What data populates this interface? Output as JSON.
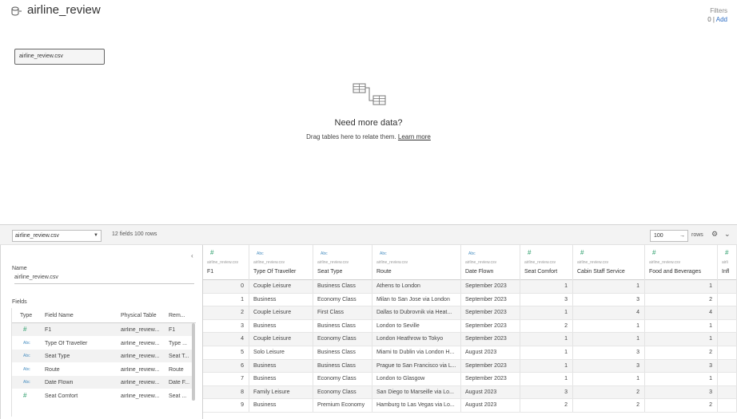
{
  "datasource": {
    "title": "airline_review",
    "icon": "datasource-icon"
  },
  "filters": {
    "label": "Filters",
    "count": "0",
    "separator": "|",
    "add": "Add"
  },
  "canvas": {
    "table_pill": "airline_review.csv",
    "need_more_data": "Need more data?",
    "drag_hint": "Drag tables here to relate them.",
    "learn_more": "Learn more"
  },
  "toolbar": {
    "table_select": "airline_review.csv",
    "info": "12 fields 100 rows",
    "rows_value": "100",
    "rows_arrow": "→",
    "rows_label": "rows",
    "gear": "⚙",
    "chevron": "⌄"
  },
  "meta": {
    "collapse": "‹",
    "name_label": "Name",
    "name_value": "airline_review.csv",
    "fields_label": "Fields",
    "headers": [
      "Type",
      "Field Name",
      "Physical Table",
      "Rem..."
    ],
    "fields": [
      {
        "type": "#",
        "type_kind": "num",
        "name": "F1",
        "table": "airline_review...",
        "remote": "F1"
      },
      {
        "type": "Abc",
        "type_kind": "str",
        "name": "Type Of Traveller",
        "table": "airline_review...",
        "remote": "Type ..."
      },
      {
        "type": "Abc",
        "type_kind": "str",
        "name": "Seat Type",
        "table": "airline_review...",
        "remote": "Seat T..."
      },
      {
        "type": "Abc",
        "type_kind": "str",
        "name": "Route",
        "table": "airline_review...",
        "remote": "Route"
      },
      {
        "type": "Abc",
        "type_kind": "str",
        "name": "Date Flown",
        "table": "airline_review...",
        "remote": "Date F..."
      },
      {
        "type": "#",
        "type_kind": "num",
        "name": "Seat Comfort",
        "table": "airline_review...",
        "remote": "Seat ..."
      }
    ]
  },
  "grid": {
    "columns": [
      {
        "type": "#",
        "type_kind": "num",
        "table": "airline_review.csv",
        "name": "F1"
      },
      {
        "type": "Abc",
        "type_kind": "str",
        "table": "airline_review.csv",
        "name": "Type Of Traveller"
      },
      {
        "type": "Abc",
        "type_kind": "str",
        "table": "airline_review.csv",
        "name": "Seat Type"
      },
      {
        "type": "Abc",
        "type_kind": "str",
        "table": "airline_review.csv",
        "name": "Route"
      },
      {
        "type": "Abc",
        "type_kind": "str",
        "table": "airline_review.csv",
        "name": "Date Flown"
      },
      {
        "type": "#",
        "type_kind": "num",
        "table": "airline_review.csv",
        "name": "Seat Comfort"
      },
      {
        "type": "#",
        "type_kind": "num",
        "table": "airline_review.csv",
        "name": "Cabin Staff Service"
      },
      {
        "type": "#",
        "type_kind": "num",
        "table": "airline_review.csv",
        "name": "Food and Beverages"
      },
      {
        "type": "#",
        "type_kind": "num",
        "table": "airli",
        "name": "Infl"
      }
    ],
    "rows": [
      [
        "0",
        "Couple Leisure",
        "Business Class",
        "Athens to London",
        "September 2023",
        "1",
        "1",
        "1",
        ""
      ],
      [
        "1",
        "Business",
        "Economy Class",
        "Milan to San Jose via London",
        "September 2023",
        "3",
        "3",
        "2",
        ""
      ],
      [
        "2",
        "Couple Leisure",
        "First Class",
        "Dallas to Dubrovnik via Heat...",
        "September 2023",
        "1",
        "4",
        "4",
        ""
      ],
      [
        "3",
        "Business",
        "Business Class",
        "London to Seville",
        "September 2023",
        "2",
        "1",
        "1",
        ""
      ],
      [
        "4",
        "Couple Leisure",
        "Economy Class",
        "London Heathrow to Tokyo",
        "September 2023",
        "1",
        "1",
        "1",
        ""
      ],
      [
        "5",
        "Solo Leisure",
        "Business Class",
        "Miami to Dublin via London H...",
        "August 2023",
        "1",
        "3",
        "2",
        ""
      ],
      [
        "6",
        "Business",
        "Business Class",
        "Prague to San Francisco via L...",
        "September 2023",
        "1",
        "3",
        "3",
        ""
      ],
      [
        "7",
        "Business",
        "Economy Class",
        "London to Glasgow",
        "September 2023",
        "1",
        "1",
        "1",
        ""
      ],
      [
        "8",
        "Family Leisure",
        "Economy Class",
        "San Diego to Marseille via Lo...",
        "August 2023",
        "3",
        "2",
        "3",
        ""
      ],
      [
        "9",
        "Business",
        "Premium Economy",
        "Hamburg to Las Vegas via Lo...",
        "August 2023",
        "2",
        "2",
        "2",
        ""
      ]
    ]
  }
}
